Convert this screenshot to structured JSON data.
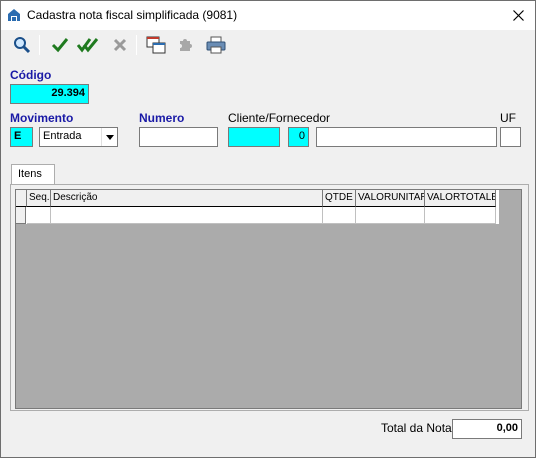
{
  "window": {
    "title": "Cadastra nota fiscal simplificada (9081)"
  },
  "toolbar": {
    "buttons": [
      {
        "icon": "search-icon"
      },
      {
        "icon": "check-icon"
      },
      {
        "icon": "double-check-icon"
      },
      {
        "icon": "x-icon"
      },
      {
        "icon": "windows-icon"
      },
      {
        "icon": "puzzle-icon"
      },
      {
        "icon": "printer-icon"
      }
    ]
  },
  "form": {
    "codigo_label": "Código",
    "codigo_value": "29.394",
    "movimento_label": "Movimento",
    "movimento_code": "E",
    "movimento_select": "Entrada",
    "numero_label": "Numero",
    "numero_value": "",
    "cliente_label": "Cliente/Fornecedor",
    "cliente_code": "",
    "cliente_number": "0",
    "cliente_name": "",
    "uf_label": "UF",
    "uf_value": ""
  },
  "tabs": {
    "itens_label": "Itens"
  },
  "grid": {
    "columns": [
      "Seq.",
      "Descrição",
      "QTDE",
      "VALORUNITAR",
      "VALORTOTALB"
    ]
  },
  "footer": {
    "total_label": "Total da Nota",
    "total_value": "0,00"
  },
  "colors": {
    "label_blue": "#1a1aa6",
    "field_cyan": "#00ffff"
  }
}
